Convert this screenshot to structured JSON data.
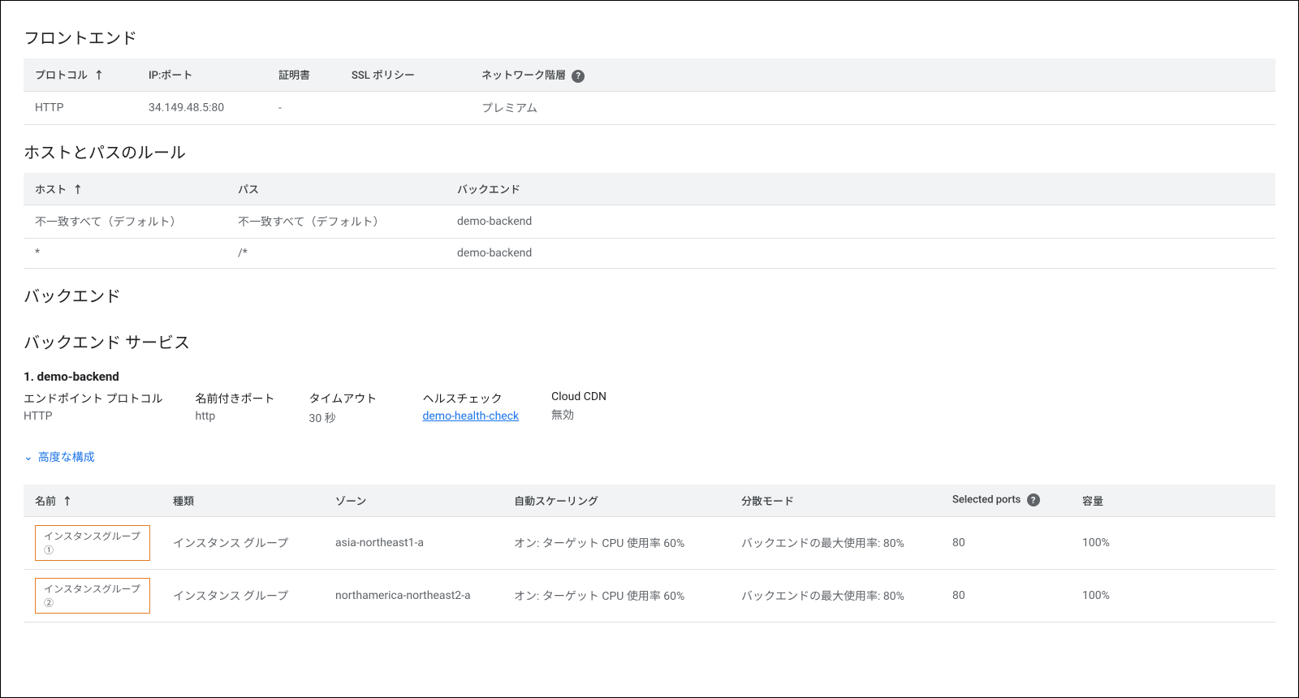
{
  "frontend": {
    "title": "フロントエンド",
    "columns": {
      "protocol": "プロトコル",
      "ip_port": "IP:ポート",
      "certificate": "証明書",
      "ssl_policy": "SSL ポリシー",
      "network_tier": "ネットワーク階層"
    },
    "rows": [
      {
        "protocol": "HTTP",
        "ip_port": "34.149.48.5:80",
        "certificate": "-",
        "ssl_policy": "",
        "network_tier": "プレミアム"
      }
    ]
  },
  "host_path": {
    "title": "ホストとパスのルール",
    "columns": {
      "host": "ホスト",
      "path": "パス",
      "backend": "バックエンド"
    },
    "rows": [
      {
        "host": "不一致すべて（デフォルト）",
        "path": "不一致すべて（デフォルト）",
        "backend": "demo-backend"
      },
      {
        "host": "*",
        "path": "/*",
        "backend": "demo-backend"
      }
    ]
  },
  "backend": {
    "title": "バックエンド",
    "service_title": "バックエンド サービス",
    "service_name": "1. demo-backend",
    "details": {
      "endpoint_protocol_label": "エンドポイント プロトコル",
      "endpoint_protocol_value": "HTTP",
      "named_port_label": "名前付きポート",
      "named_port_value": "http",
      "timeout_label": "タイムアウト",
      "timeout_value": "30 秒",
      "health_check_label": "ヘルスチェック",
      "health_check_value": "demo-health-check",
      "cdn_label": "Cloud CDN",
      "cdn_value": "無効"
    },
    "advanced_toggle": "高度な構成",
    "instances": {
      "columns": {
        "name": "名前",
        "type": "種類",
        "zone": "ゾーン",
        "autoscaling": "自動スケーリング",
        "balancing_mode": "分散モード",
        "selected_ports": "Selected ports",
        "capacity": "容量"
      },
      "rows": [
        {
          "name": "インスタンスグループ①",
          "type": "インスタンス グループ",
          "zone": "asia-northeast1-a",
          "autoscaling": "オン: ターゲット CPU 使用率 60%",
          "balancing_mode": "バックエンドの最大使用率: 80%",
          "selected_ports": "80",
          "capacity": "100%"
        },
        {
          "name": "インスタンスグループ②",
          "type": "インスタンス グループ",
          "zone": "northamerica-northeast2-a",
          "autoscaling": "オン: ターゲット CPU 使用率 60%",
          "balancing_mode": "バックエンドの最大使用率: 80%",
          "selected_ports": "80",
          "capacity": "100%"
        }
      ]
    }
  },
  "icons": {
    "sort_arrow": "↑",
    "help": "?",
    "chevron": "⌄"
  }
}
